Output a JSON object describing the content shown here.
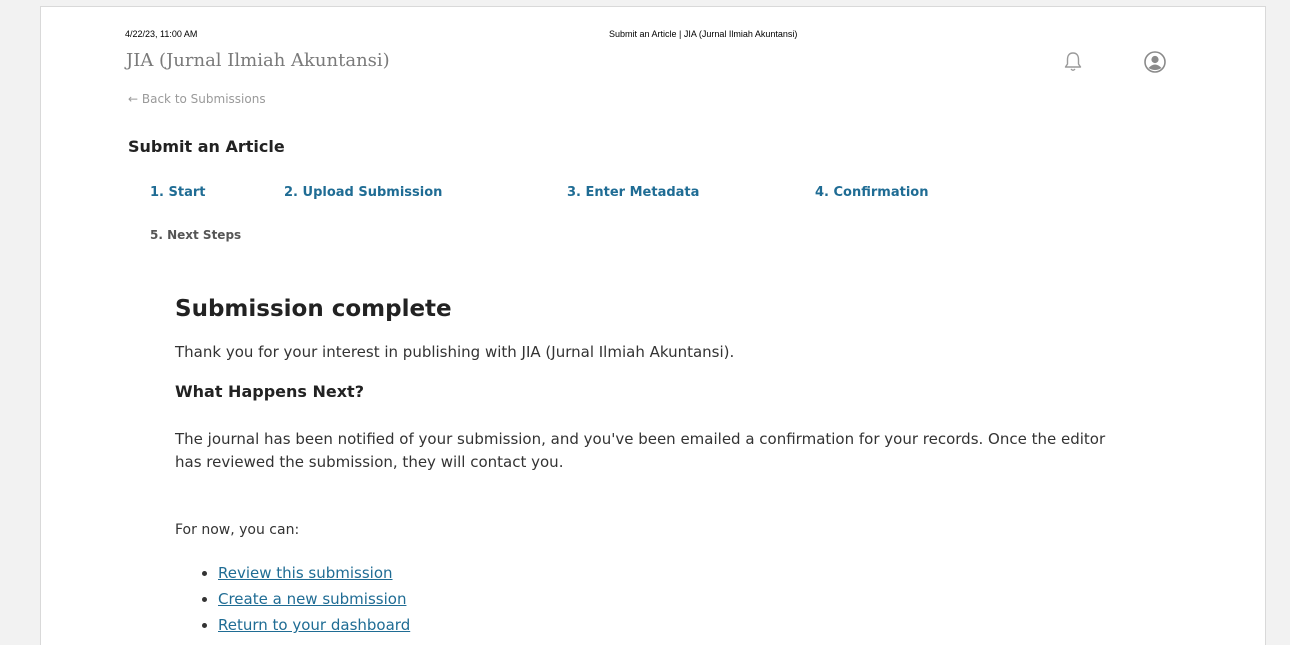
{
  "print_header": {
    "datetime": "4/22/23, 11:00 AM",
    "page_title": "Submit an Article | JIA (Jurnal Ilmiah Akuntansi)"
  },
  "header": {
    "journal_title": "JIA (Jurnal Ilmiah Akuntansi)",
    "icons": [
      "bell-icon",
      "user-icon"
    ]
  },
  "nav": {
    "back_link": "← Back to Submissions"
  },
  "main": {
    "title": "Submit an Article",
    "steps": [
      {
        "label": "1. Start"
      },
      {
        "label": "2. Upload Submission"
      },
      {
        "label": "3. Enter Metadata"
      },
      {
        "label": "4. Confirmation"
      },
      {
        "label": "5. Next Steps"
      }
    ],
    "heading": "Submission complete",
    "thanks": "Thank you for your interest in publishing with JIA (Jurnal Ilmiah Akuntansi).",
    "subheading": "What Happens Next?",
    "notified": "The journal has been notified of your submission, and you've been emailed a confirmation for your records. Once the editor has reviewed the submission, they will contact you.",
    "for_now": "For now, you can:",
    "links": [
      {
        "label": "Review this submission"
      },
      {
        "label": "Create a new submission"
      },
      {
        "label": "Return to your dashboard"
      }
    ]
  },
  "colors": {
    "link": "#1f6c94",
    "muted": "#7a7a7a",
    "text": "#333333"
  }
}
